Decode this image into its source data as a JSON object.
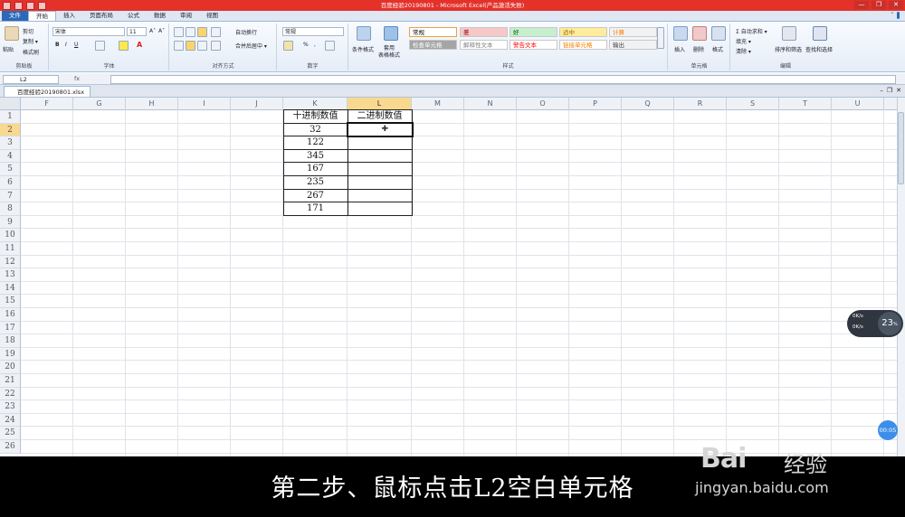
{
  "window": {
    "title": "百度经验20190801 - Microsoft Excel(产品激活失败)",
    "controls": [
      "—",
      "❐",
      "✕"
    ]
  },
  "ribbon_tabs": [
    {
      "label": "文件",
      "kind": "file"
    },
    {
      "label": "开始",
      "kind": "active"
    },
    {
      "label": "插入"
    },
    {
      "label": "页面布局"
    },
    {
      "label": "公式"
    },
    {
      "label": "数据"
    },
    {
      "label": "审阅"
    },
    {
      "label": "视图"
    }
  ],
  "clipboard": {
    "paste": "粘贴",
    "cut": "剪切",
    "copy": "复制 ▾",
    "painter": "格式刷",
    "group": "剪贴板"
  },
  "font": {
    "name": "宋体",
    "size": "11",
    "grow": "A˄",
    "shrink": "A˅",
    "bold": "B",
    "italic": "I",
    "underline": "U",
    "font_color_glyph": "A",
    "group": "字体"
  },
  "alignment": {
    "wrap": "自动换行",
    "merge": "合并后居中 ▾",
    "group": "对齐方式"
  },
  "number": {
    "format": "常规",
    "percent": "%",
    "comma": ",",
    "group": "数字"
  },
  "styles": {
    "cond_format": "条件格式",
    "table_format": "套用\n表格格式",
    "cells": [
      {
        "label": "常规",
        "bg": "#ffffff",
        "fg": "#000000",
        "border": "#e8a33c"
      },
      {
        "label": "差",
        "bg": "#f6c8c8",
        "fg": "#9c0006"
      },
      {
        "label": "好",
        "bg": "#c6efce",
        "fg": "#006100"
      },
      {
        "label": "适中",
        "bg": "#ffeb9c",
        "fg": "#9c6500"
      },
      {
        "label": "计算",
        "bg": "#f2f2f2",
        "fg": "#fa7d00"
      },
      {
        "label": "检查单元格",
        "bg": "#a5a5a5",
        "fg": "#ffffff"
      },
      {
        "label": "解释性文本",
        "bg": "#ffffff",
        "fg": "#7f7f7f"
      },
      {
        "label": "警告文本",
        "bg": "#ffffff",
        "fg": "#ff0000"
      },
      {
        "label": "链接单元格",
        "bg": "#ffffff",
        "fg": "#fa7d00"
      },
      {
        "label": "输出",
        "bg": "#f2f2f2",
        "fg": "#3f3f3f"
      }
    ],
    "group": "样式"
  },
  "cells_group": {
    "insert": "插入",
    "delete": "删除",
    "format": "格式",
    "group": "单元格"
  },
  "editing": {
    "autosum": "Σ 自动求和 ▾",
    "fill": "填充 ▾",
    "clear": "清除 ▾",
    "sort": "排序和筛选",
    "find": "查找和选择",
    "group": "编辑"
  },
  "formula_bar": {
    "name_box": "L2",
    "fx": "fx",
    "value": ""
  },
  "workbook_tab": {
    "name": "百度经验20190801.xlsx"
  },
  "columns": [
    "F",
    "G",
    "H",
    "I",
    "J",
    "K",
    "L",
    "M",
    "N",
    "O",
    "P",
    "Q",
    "R",
    "S",
    "T",
    "U"
  ],
  "selected_column": "L",
  "rows": [
    "1",
    "2",
    "3",
    "4",
    "5",
    "6",
    "7",
    "8",
    "9",
    "10",
    "11",
    "12",
    "13",
    "14",
    "15",
    "16",
    "17",
    "18",
    "19",
    "20",
    "21",
    "22",
    "23",
    "24",
    "25",
    "26"
  ],
  "selected_row": "2",
  "table": {
    "headers": [
      "十进制数值",
      "二进制数值"
    ],
    "decimal_values": [
      "32",
      "122",
      "345",
      "167",
      "235",
      "267",
      "171"
    ],
    "binary_values": [
      "",
      "",
      "",
      "",
      "",
      "",
      ""
    ]
  },
  "net_widget": {
    "percent": "23",
    "unit": "%",
    "up": "0",
    "down": "0",
    "rate_unit": "K/s"
  },
  "clock_badge": "00:05",
  "caption": "第二步、鼠标点击L2空白单元格",
  "watermark": {
    "logo": "Bai",
    "logo_suffix": "经验",
    "site": "jingyan.baidu.com"
  }
}
